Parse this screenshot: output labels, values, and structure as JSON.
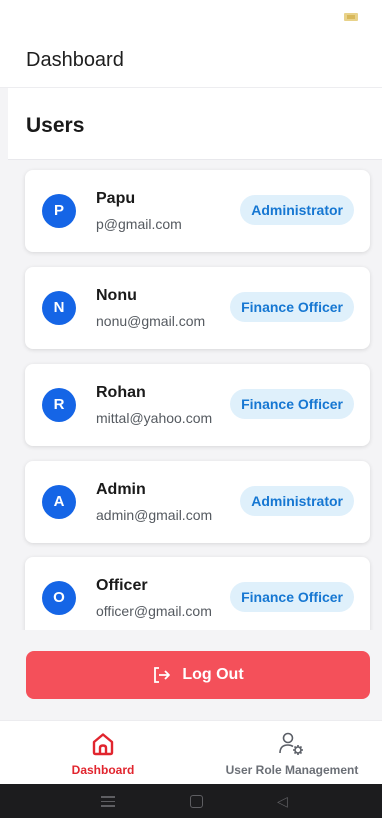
{
  "header": {
    "title": "Dashboard"
  },
  "section": {
    "title": "Users"
  },
  "users": [
    {
      "initial": "P",
      "name": "Papu",
      "email": "p@gmail.com",
      "role": "Administrator"
    },
    {
      "initial": "N",
      "name": "Nonu",
      "email": "nonu@gmail.com",
      "role": "Finance Officer"
    },
    {
      "initial": "R",
      "name": "Rohan",
      "email": "mittal@yahoo.com",
      "role": "Finance Officer"
    },
    {
      "initial": "A",
      "name": "Admin",
      "email": "admin@gmail.com",
      "role": "Administrator"
    },
    {
      "initial": "O",
      "name": "Officer",
      "email": "officer@gmail.com",
      "role": "Finance Officer"
    }
  ],
  "logout": {
    "label": "Log Out",
    "icon": "logout-icon"
  },
  "bottom_nav": {
    "items": [
      {
        "label": "Dashboard",
        "icon": "home-icon",
        "active": true
      },
      {
        "label": "User Role Management",
        "icon": "user-settings-icon",
        "active": false
      }
    ]
  },
  "colors": {
    "accent_red": "#e1252e",
    "logout_bg": "#f4505a",
    "avatar_bg": "#1565e6",
    "badge_bg": "#dff0fb",
    "badge_text": "#1677d2"
  }
}
